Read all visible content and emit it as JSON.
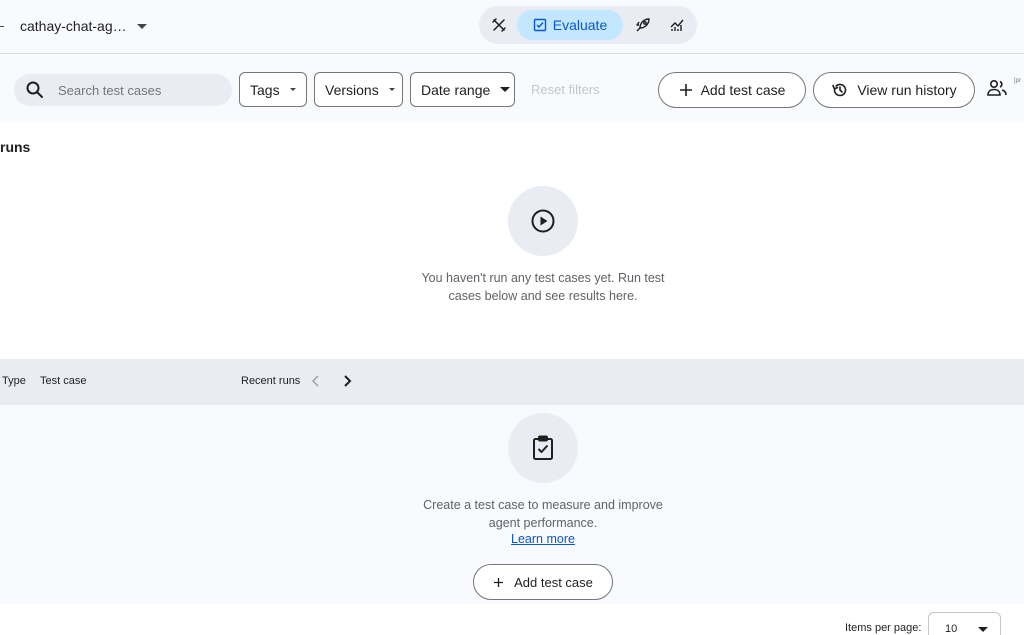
{
  "header": {
    "agent_name": "cathay-chat-ag…",
    "modes": [
      {
        "name": "build",
        "icon": "tools-icon"
      },
      {
        "name": "evaluate",
        "label": "Evaluate",
        "icon": "checklist-icon",
        "selected": true
      },
      {
        "name": "deploy",
        "icon": "rocket-icon"
      },
      {
        "name": "monitor",
        "icon": "analytics-icon"
      }
    ],
    "accent_color": "#0b57d0",
    "selected_bg": "#c2e7ff"
  },
  "toolbar": {
    "search_placeholder": "Search test cases",
    "tags_label": "Tags",
    "versions_label": "Versions",
    "date_range_label": "Date range",
    "reset_label": "Reset filters",
    "add_test_case_label": "Add test case",
    "view_history_label": "View run history",
    "share_superscript": "[pr"
  },
  "runs": {
    "title": "runs",
    "empty_message": "You haven't run any test cases yet. Run test cases below and see results here."
  },
  "table": {
    "columns": [
      "Type",
      "Test case",
      "Recent runs"
    ]
  },
  "cases": {
    "empty_message": "Create a test case to measure and improve agent performance.",
    "learn_more": "Learn more",
    "add_label": "Add test case"
  },
  "pagination": {
    "items_per_page_label": "Items per page:",
    "items_per_page_value": "10"
  }
}
